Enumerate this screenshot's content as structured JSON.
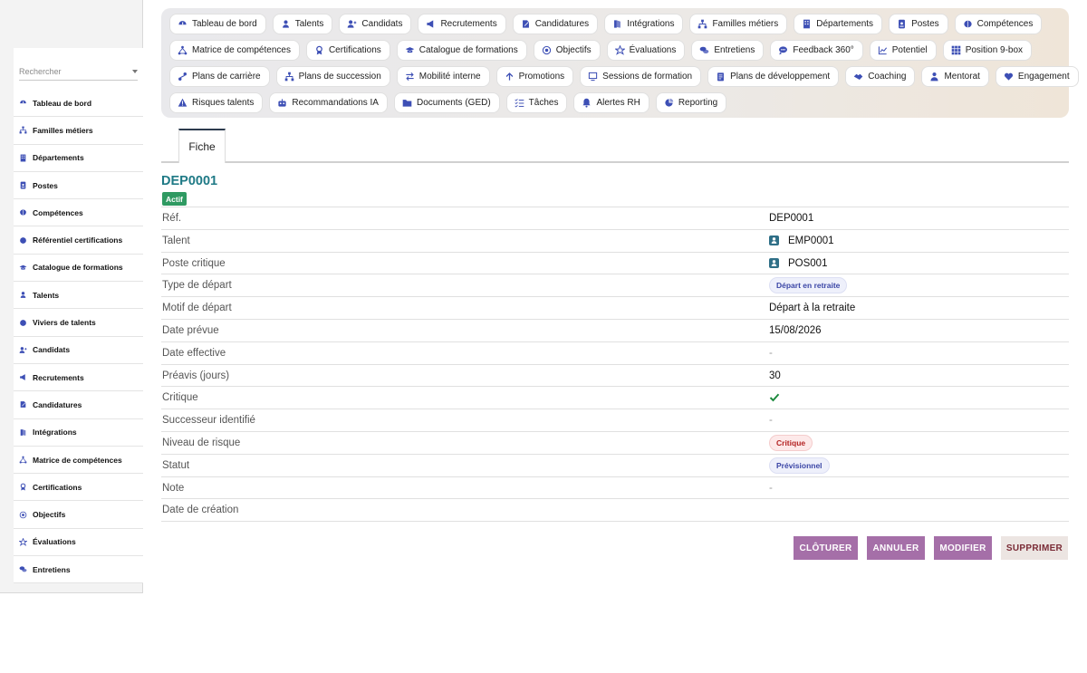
{
  "sidebar": {
    "search_placeholder": "Rechercher",
    "items": [
      {
        "label": "Tableau de bord",
        "icon": "dashboard-icon"
      },
      {
        "label": "Familles métiers",
        "icon": "sitemap-icon"
      },
      {
        "label": "Départements",
        "icon": "building-icon"
      },
      {
        "label": "Postes",
        "icon": "id-badge-icon"
      },
      {
        "label": "Compétences",
        "icon": "brain-icon"
      },
      {
        "label": "Référentiel certifications",
        "icon": "certificate-icon"
      },
      {
        "label": "Catalogue de formations",
        "icon": "graduation-cap-icon"
      },
      {
        "label": "Talents",
        "icon": "user-icon"
      },
      {
        "label": "Viviers de talents",
        "icon": "layers-icon"
      },
      {
        "label": "Candidats",
        "icon": "user-plus-icon"
      },
      {
        "label": "Recrutements",
        "icon": "megaphone-icon"
      },
      {
        "label": "Candidatures",
        "icon": "file-signature-icon"
      },
      {
        "label": "Intégrations",
        "icon": "door-open-icon"
      },
      {
        "label": "Matrice de compétences",
        "icon": "network-icon"
      },
      {
        "label": "Certifications",
        "icon": "award-icon"
      },
      {
        "label": "Objectifs",
        "icon": "target-icon"
      },
      {
        "label": "Évaluations",
        "icon": "star-icon"
      },
      {
        "label": "Entretiens",
        "icon": "comments-icon"
      }
    ]
  },
  "nav": {
    "rows": [
      [
        {
          "label": "Tableau de bord",
          "icon": "dashboard-icon"
        },
        {
          "label": "Talents",
          "icon": "user-icon"
        },
        {
          "label": "Candidats",
          "icon": "user-plus-icon"
        },
        {
          "label": "Recrutements",
          "icon": "megaphone-icon"
        },
        {
          "label": "Candidatures",
          "icon": "file-signature-icon"
        },
        {
          "label": "Intégrations",
          "icon": "door-open-icon"
        },
        {
          "label": "Familles métiers",
          "icon": "sitemap-icon"
        },
        {
          "label": "Départements",
          "icon": "building-icon"
        },
        {
          "label": "Postes",
          "icon": "id-badge-icon"
        },
        {
          "label": "Compétences",
          "icon": "brain-icon"
        }
      ],
      [
        {
          "label": "Matrice de compétences",
          "icon": "network-icon"
        },
        {
          "label": "Certifications",
          "icon": "award-icon"
        },
        {
          "label": "Catalogue de formations",
          "icon": "graduation-cap-icon"
        },
        {
          "label": "Objectifs",
          "icon": "target-icon"
        },
        {
          "label": "Évaluations",
          "icon": "star-icon"
        },
        {
          "label": "Entretiens",
          "icon": "comments-icon"
        },
        {
          "label": "Feedback 360°",
          "icon": "comment-dots-icon"
        },
        {
          "label": "Potentiel",
          "icon": "chart-line-icon"
        },
        {
          "label": "Position 9-box",
          "icon": "grid-icon"
        }
      ],
      [
        {
          "label": "Plans de carrière",
          "icon": "route-icon"
        },
        {
          "label": "Plans de succession",
          "icon": "sitemap-icon"
        },
        {
          "label": "Mobilité interne",
          "icon": "exchange-icon"
        },
        {
          "label": "Promotions",
          "icon": "arrow-up-icon"
        },
        {
          "label": "Sessions de formation",
          "icon": "chalkboard-icon"
        },
        {
          "label": "Plans de développement",
          "icon": "clipboard-icon"
        },
        {
          "label": "Coaching",
          "icon": "handshake-icon"
        },
        {
          "label": "Mentorat",
          "icon": "user-tie-icon"
        },
        {
          "label": "Engagement",
          "icon": "heart-icon"
        }
      ],
      [
        {
          "label": "Risques talents",
          "icon": "warning-icon"
        },
        {
          "label": "Recommandations IA",
          "icon": "robot-icon"
        },
        {
          "label": "Documents (GED)",
          "icon": "folder-icon"
        },
        {
          "label": "Tâches",
          "icon": "list-check-icon"
        },
        {
          "label": "Alertes RH",
          "icon": "bell-icon"
        },
        {
          "label": "Reporting",
          "icon": "pie-chart-icon"
        }
      ]
    ]
  },
  "tabs": {
    "active": "Fiche"
  },
  "record": {
    "title": "DEP0001",
    "status_badge": "Actif",
    "fields": [
      {
        "label": "Réf.",
        "value": "DEP0001",
        "kind": "text"
      },
      {
        "label": "Talent",
        "value": "EMP0001",
        "kind": "link"
      },
      {
        "label": "Poste critique",
        "value": "POS001",
        "kind": "link"
      },
      {
        "label": "Type de départ",
        "value": "Départ en retraite",
        "kind": "pill-blue"
      },
      {
        "label": "Motif de départ",
        "value": "Départ à la retraite",
        "kind": "text"
      },
      {
        "label": "Date prévue",
        "value": "15/08/2026",
        "kind": "text"
      },
      {
        "label": "Date effective",
        "value": "-",
        "kind": "dash"
      },
      {
        "label": "Préavis (jours)",
        "value": "30",
        "kind": "text"
      },
      {
        "label": "Critique",
        "value": "",
        "kind": "check"
      },
      {
        "label": "Successeur identifié",
        "value": "-",
        "kind": "dash"
      },
      {
        "label": "Niveau de risque",
        "value": "Critique",
        "kind": "pill-red"
      },
      {
        "label": "Statut",
        "value": "Prévisionnel",
        "kind": "pill-blue"
      },
      {
        "label": "Note",
        "value": "-",
        "kind": "dash"
      },
      {
        "label": "Date de création",
        "value": "",
        "kind": "text"
      }
    ]
  },
  "actions": {
    "close": "CLÔTURER",
    "cancel": "ANNULER",
    "edit": "MODIFIER",
    "delete": "SUPPRIMER"
  },
  "colors": {
    "accent_purple": "#a56fa8",
    "title_teal": "#1f7a86",
    "active_green": "#2f9a62",
    "icon_blue": "#3d4fb5"
  }
}
